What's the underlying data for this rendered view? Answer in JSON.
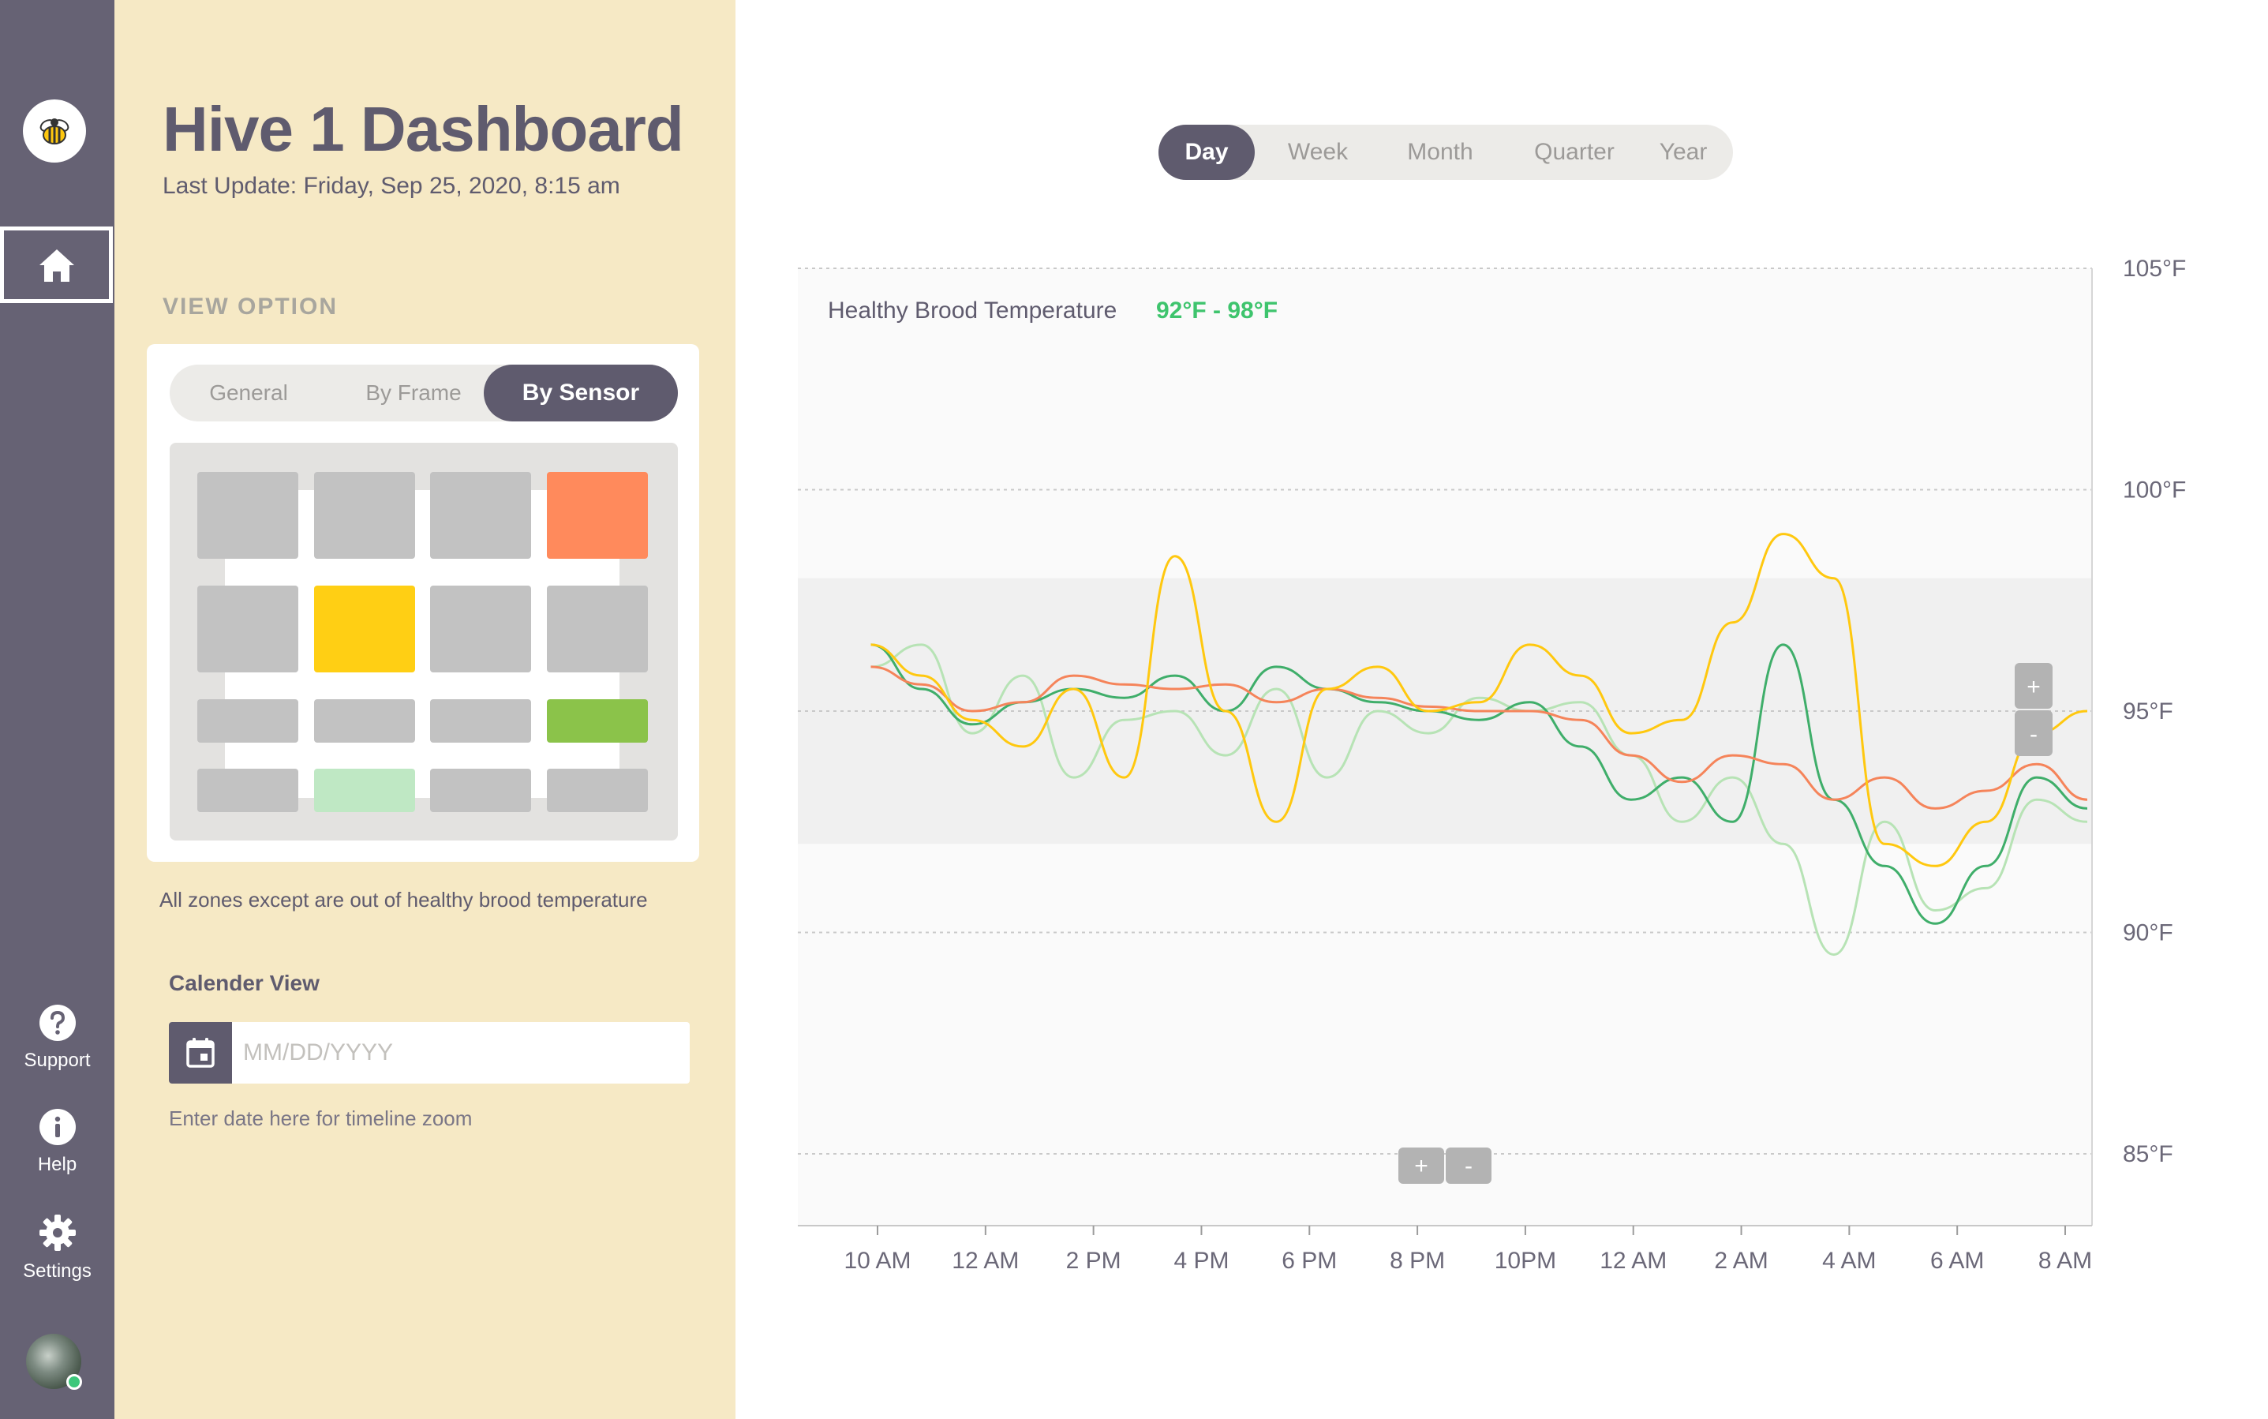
{
  "sidebar": {
    "items": [
      {
        "id": "home",
        "icon": "home-icon",
        "label": ""
      },
      {
        "id": "support",
        "icon": "question-icon",
        "label": "Support"
      },
      {
        "id": "help",
        "icon": "info-icon",
        "label": "Help"
      },
      {
        "id": "settings",
        "icon": "gear-icon",
        "label": "Settings"
      }
    ],
    "logo_icon": "bee-icon",
    "avatar_status_color": "#3cc77a"
  },
  "header": {
    "title": "Hive 1 Dashboard",
    "last_update": "Last Update: Friday, Sep 25, 2020, 8:15 am"
  },
  "view_option": {
    "label": "VIEW OPTION",
    "options": [
      "General",
      "By Frame",
      "By Sensor"
    ],
    "selected": "By Sensor",
    "sensor_grid": [
      [
        "#c2c2c2",
        "#c2c2c2",
        "#c2c2c2",
        "#ff8a5c"
      ],
      [
        "#c2c2c2",
        "#ffcf14",
        "#c2c2c2",
        "#c2c2c2"
      ],
      [
        "#c2c2c2",
        "#c2c2c2",
        "#c2c2c2",
        "#8bc34a"
      ],
      [
        "#c2c2c2",
        "#bfe8c4",
        "#c2c2c2",
        "#c2c2c2"
      ]
    ],
    "note": "All zones except are out of healthy brood temperature"
  },
  "calendar": {
    "label": "Calender View",
    "placeholder": "MM/DD/YYYY",
    "value": "",
    "hint": "Enter date here for timeline zoom",
    "icon": "calendar-icon"
  },
  "timeframe": {
    "options": [
      "Day",
      "Week",
      "Month",
      "Quarter",
      "Year"
    ],
    "selected": "Day"
  },
  "chart_data": {
    "type": "line",
    "annotation_label": "Healthy Brood Temperature",
    "annotation_range": "92°F - 98°F",
    "annotation_color": "#3ec46d",
    "band": [
      92,
      98
    ],
    "ylim": [
      83.5,
      105
    ],
    "y_ticks": [
      105,
      100,
      95,
      90,
      85
    ],
    "y_tick_labels": [
      "105°F",
      "100°F",
      "95°F",
      "90°F",
      "85°F"
    ],
    "x_tick_labels": [
      "10 AM",
      "12 AM",
      "2 PM",
      "4 PM",
      "6 PM",
      "8 PM",
      "10PM",
      "12 AM",
      "2 AM",
      "4 AM",
      "6 AM",
      "8 AM"
    ],
    "x": [
      0,
      0.5,
      1,
      1.5,
      2,
      2.5,
      3,
      3.5,
      4,
      4.5,
      5,
      5.5,
      6,
      6.5,
      7,
      7.5,
      8,
      8.5,
      9,
      9.5,
      10,
      10.5,
      11,
      11.5,
      12
    ],
    "series": [
      {
        "color": "#ffc80f",
        "values": [
          96.5,
          95.8,
          94.8,
          94.2,
          95.5,
          93.5,
          98.5,
          95.0,
          92.5,
          95.5,
          96.0,
          95.0,
          95.2,
          96.5,
          95.8,
          94.5,
          94.8,
          97.0,
          99.0,
          98.0,
          92.0,
          91.5,
          92.5,
          94.5,
          95.0
        ]
      },
      {
        "color": "#f5845a",
        "values": [
          96.0,
          95.6,
          95.0,
          95.2,
          95.8,
          95.6,
          95.5,
          95.6,
          95.2,
          95.5,
          95.3,
          95.1,
          95.0,
          95.0,
          94.8,
          94.0,
          93.4,
          94.0,
          93.8,
          93.0,
          93.5,
          92.8,
          93.2,
          93.8,
          93.0
        ]
      },
      {
        "color": "#3fae6a",
        "values": [
          96.5,
          95.5,
          94.7,
          95.2,
          95.5,
          95.3,
          95.8,
          95.0,
          96.0,
          95.5,
          95.2,
          95.0,
          94.8,
          95.2,
          94.2,
          93.0,
          93.5,
          92.5,
          96.5,
          93.0,
          91.5,
          90.2,
          91.5,
          93.5,
          92.8
        ]
      },
      {
        "color": "#b7e3b5",
        "values": [
          96.0,
          96.5,
          94.5,
          95.8,
          93.5,
          94.8,
          95.0,
          94.0,
          95.5,
          93.5,
          95.0,
          94.5,
          95.3,
          95.0,
          95.2,
          94.0,
          92.5,
          93.5,
          92.0,
          89.5,
          92.5,
          90.5,
          91.0,
          93.0,
          92.5
        ]
      }
    ]
  }
}
